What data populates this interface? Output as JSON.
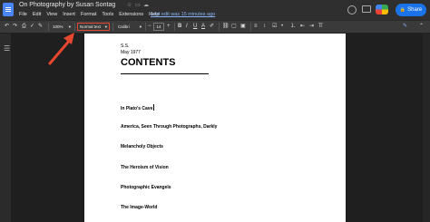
{
  "doc": {
    "title": "On Photography by Susan Sontag",
    "last_edit": "Last edit was 15 minutes ago"
  },
  "menu": [
    "File",
    "Edit",
    "View",
    "Insert",
    "Format",
    "Tools",
    "Extensions",
    "Help"
  ],
  "share_label": "Share",
  "toolbar": {
    "zoom": "100%",
    "style": "Normal text",
    "font": "Calibri",
    "size": "14",
    "bold": "B",
    "italic": "I",
    "underline": "U",
    "text_color": "A"
  },
  "page": {
    "initials": "S.S.",
    "date": "May 1977",
    "contents": "CONTENTS",
    "sections": [
      "In Plato's Cave",
      "America, Seen Through Photographs, Darkly",
      "Melancholy Objects",
      "The Heroism of Vision",
      "Photographic Evangels",
      "The Image-World"
    ]
  },
  "colors": {
    "accent": "#1a73e8",
    "arrow": "#e8472f"
  }
}
